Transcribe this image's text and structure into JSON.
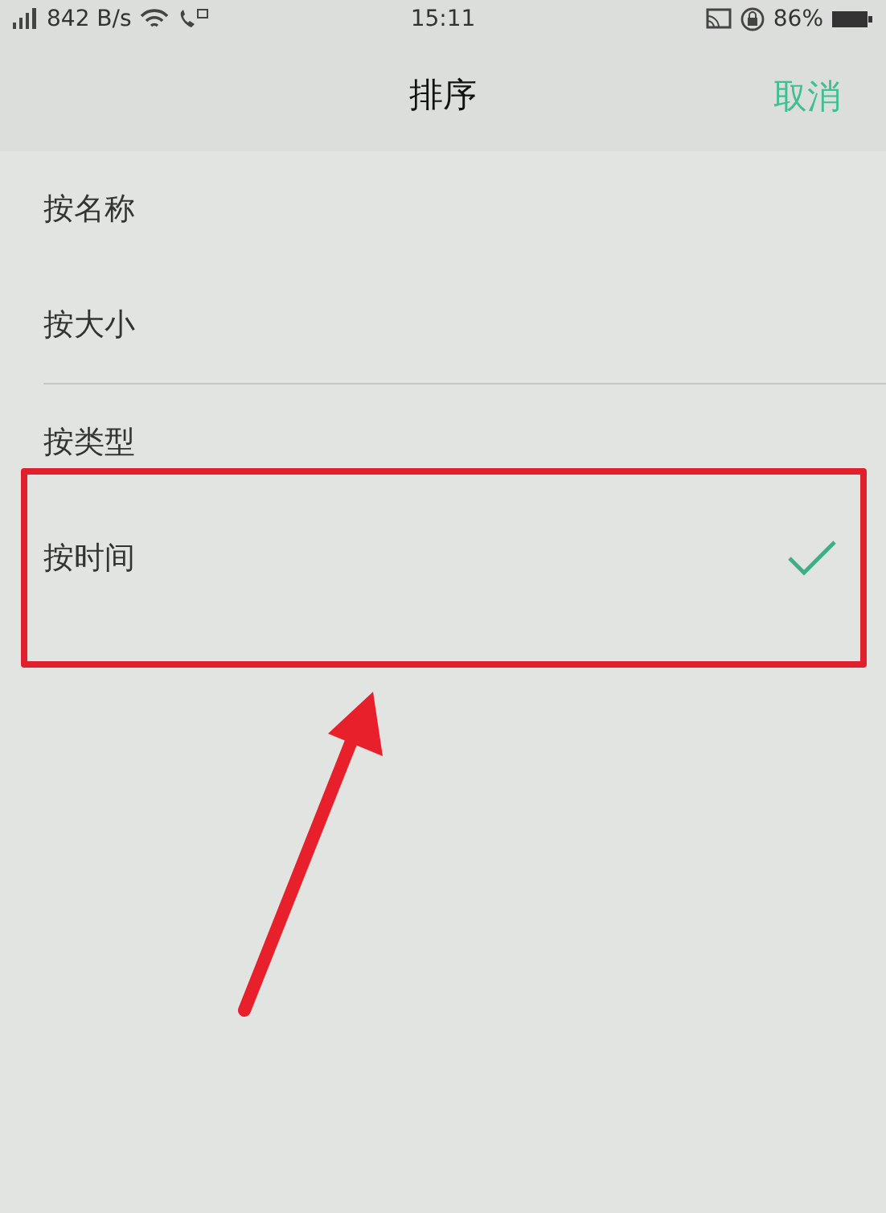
{
  "status_bar": {
    "speed": "842 B/s",
    "time": "15:11",
    "battery": "86%"
  },
  "header": {
    "title": "排序",
    "cancel": "取消"
  },
  "groups": [
    {
      "items": [
        {
          "label": "按名称",
          "selected": false
        },
        {
          "label": "按大小",
          "selected": false
        }
      ]
    },
    {
      "items": [
        {
          "label": "按类型",
          "selected": false
        },
        {
          "label": "按时间",
          "selected": true
        }
      ]
    }
  ]
}
